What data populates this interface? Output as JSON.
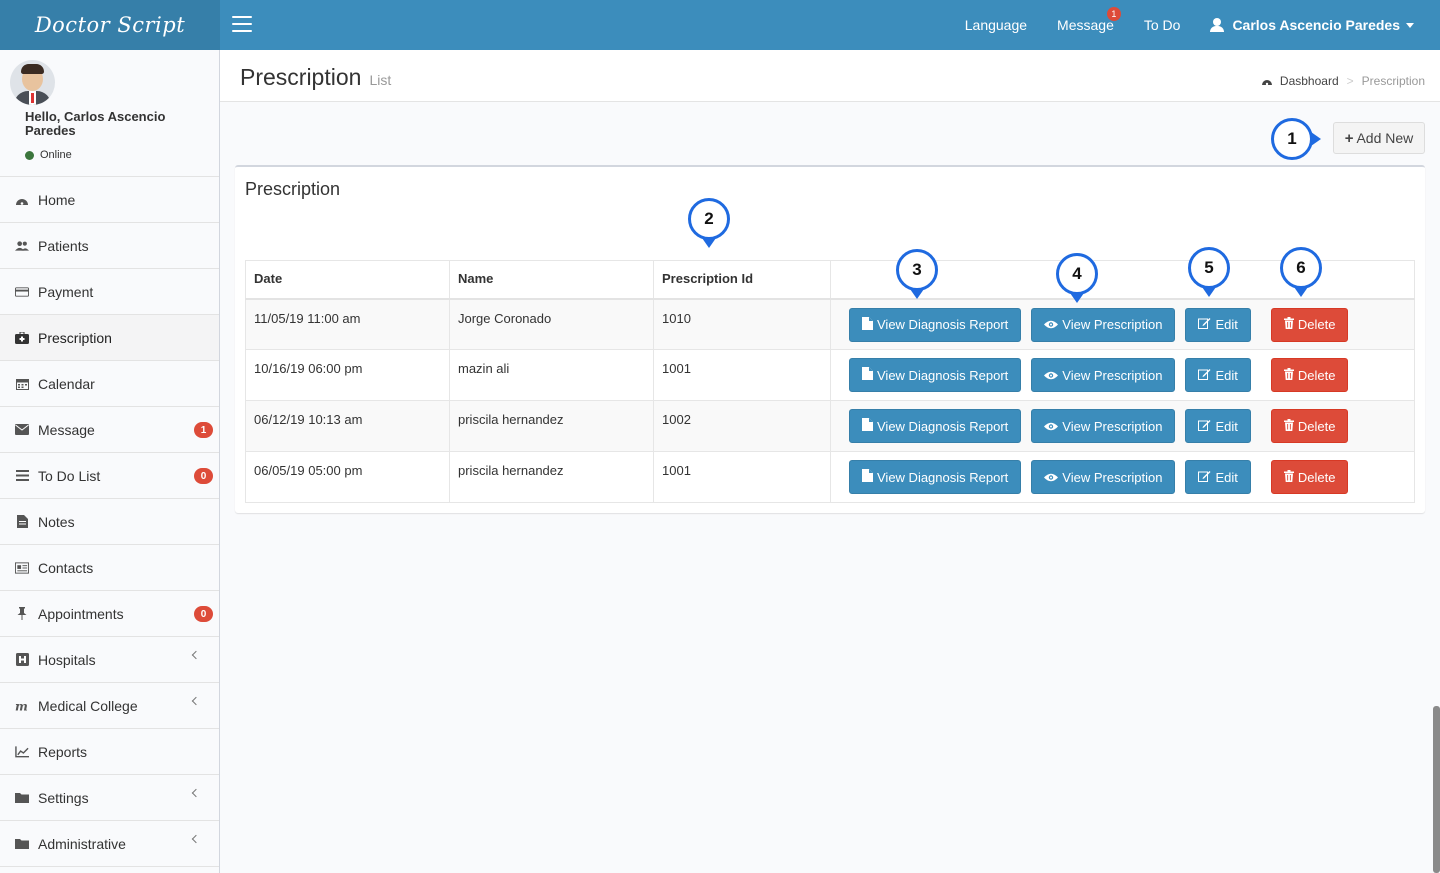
{
  "brand": {
    "name": "Doctor Script"
  },
  "navbar": {
    "language_label": "Language",
    "message_label": "Message",
    "message_badge": "1",
    "todo_label": "To Do",
    "user_name": "Carlos Ascencio Paredes"
  },
  "sidebar": {
    "greeting": "Hello, Carlos Ascencio Paredes",
    "status": "Online",
    "items": [
      {
        "label": "Home",
        "icon": "dashboard-icon"
      },
      {
        "label": "Patients",
        "icon": "users-icon"
      },
      {
        "label": "Payment",
        "icon": "credit-card-icon"
      },
      {
        "label": "Prescription",
        "icon": "medkit-icon",
        "active": true
      },
      {
        "label": "Calendar",
        "icon": "calendar-icon"
      },
      {
        "label": "Message",
        "icon": "envelope-icon",
        "badge": "1"
      },
      {
        "label": "To Do List",
        "icon": "list-icon",
        "badge": "0"
      },
      {
        "label": "Notes",
        "icon": "file-icon"
      },
      {
        "label": "Contacts",
        "icon": "address-card-icon"
      },
      {
        "label": "Appointments",
        "icon": "thumbtack-icon",
        "badge": "0"
      },
      {
        "label": "Hospitals",
        "icon": "hospital-icon",
        "expandable": true
      },
      {
        "label": "Medical College",
        "icon": "college-icon",
        "expandable": true
      },
      {
        "label": "Reports",
        "icon": "line-chart-icon"
      },
      {
        "label": "Settings",
        "icon": "folder-icon",
        "expandable": true
      },
      {
        "label": "Administrative",
        "icon": "folder-icon",
        "expandable": true
      }
    ]
  },
  "header": {
    "title": "Prescription",
    "subtitle": "List",
    "breadcrumb": {
      "home": "Dasbhoard",
      "current": "Prescription"
    }
  },
  "toolbar": {
    "add_label": "Add New"
  },
  "box": {
    "title": "Prescription"
  },
  "table": {
    "columns": [
      "Date",
      "Name",
      "Prescription Id"
    ],
    "rows": [
      {
        "date": "11/05/19 11:00 am",
        "name": "Jorge Coronado",
        "id": "1010"
      },
      {
        "date": "10/16/19 06:00 pm",
        "name": "mazin ali",
        "id": "1001"
      },
      {
        "date": "06/12/19 10:13 am",
        "name": "priscila hernandez",
        "id": "1002"
      },
      {
        "date": "06/05/19 05:00 pm",
        "name": "priscila hernandez",
        "id": "1001"
      }
    ],
    "actions": {
      "diagnosis": "View Diagnosis Report",
      "prescription": "View Prescription",
      "edit": "Edit",
      "delete": "Delete"
    }
  },
  "markers": [
    "1",
    "2",
    "3",
    "4",
    "5",
    "6"
  ],
  "colors": {
    "header": "#3c8dbc",
    "logo": "#367fa9",
    "danger": "#dd4b39",
    "marker": "#1f6ae0"
  }
}
